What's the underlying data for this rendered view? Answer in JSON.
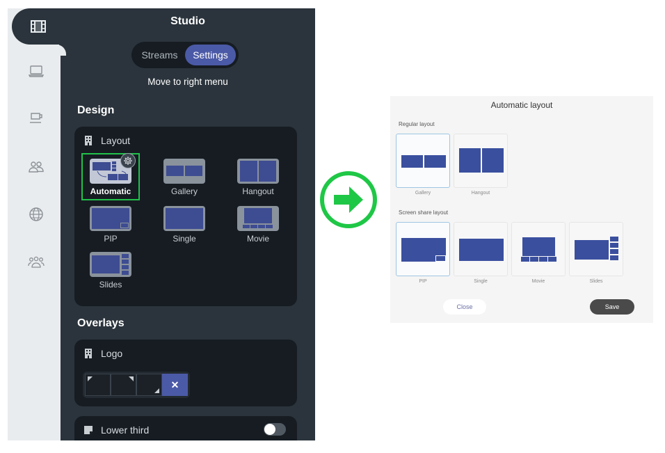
{
  "app": {
    "title": "Studio",
    "tabs": [
      {
        "label": "Streams",
        "active": false
      },
      {
        "label": "Settings",
        "active": true
      }
    ],
    "move_menu_label": "Move to right menu",
    "rail_icons": [
      "film-icon",
      "laptop-icon",
      "cup-icon",
      "people-icon",
      "globe-icon",
      "group-icon"
    ],
    "design": {
      "heading": "Design",
      "layout_card": {
        "title": "Layout",
        "options": [
          {
            "label": "Automatic",
            "selected": true
          },
          {
            "label": "Gallery",
            "selected": false
          },
          {
            "label": "Hangout",
            "selected": false
          },
          {
            "label": "PIP",
            "selected": false
          },
          {
            "label": "Single",
            "selected": false
          },
          {
            "label": "Movie",
            "selected": false
          },
          {
            "label": "Slides",
            "selected": false
          }
        ]
      }
    },
    "overlays": {
      "heading": "Overlays",
      "logo": {
        "title": "Logo",
        "positions": [
          "top-left",
          "top-right",
          "bottom-right",
          "none"
        ],
        "clear_symbol": "✕",
        "selected": "none"
      },
      "lower_third": {
        "title": "Lower third",
        "enabled": false
      }
    }
  },
  "dialog": {
    "title": "Automatic layout",
    "regular": {
      "heading": "Regular layout",
      "options": [
        {
          "label": "Gallery",
          "selected": true
        },
        {
          "label": "Hangout",
          "selected": false
        }
      ]
    },
    "screen_share": {
      "heading": "Screen share layout",
      "options": [
        {
          "label": "PIP",
          "selected": true
        },
        {
          "label": "Single",
          "selected": false
        },
        {
          "label": "Movie",
          "selected": false
        },
        {
          "label": "Slides",
          "selected": false
        }
      ]
    },
    "close_label": "Close",
    "save_label": "Save"
  },
  "colors": {
    "accent": "#4b5aa7",
    "selection_green": "#22c24a",
    "arrow_green": "#1fc746",
    "panel_bg": "#2b343c",
    "card_bg": "#161c22"
  }
}
